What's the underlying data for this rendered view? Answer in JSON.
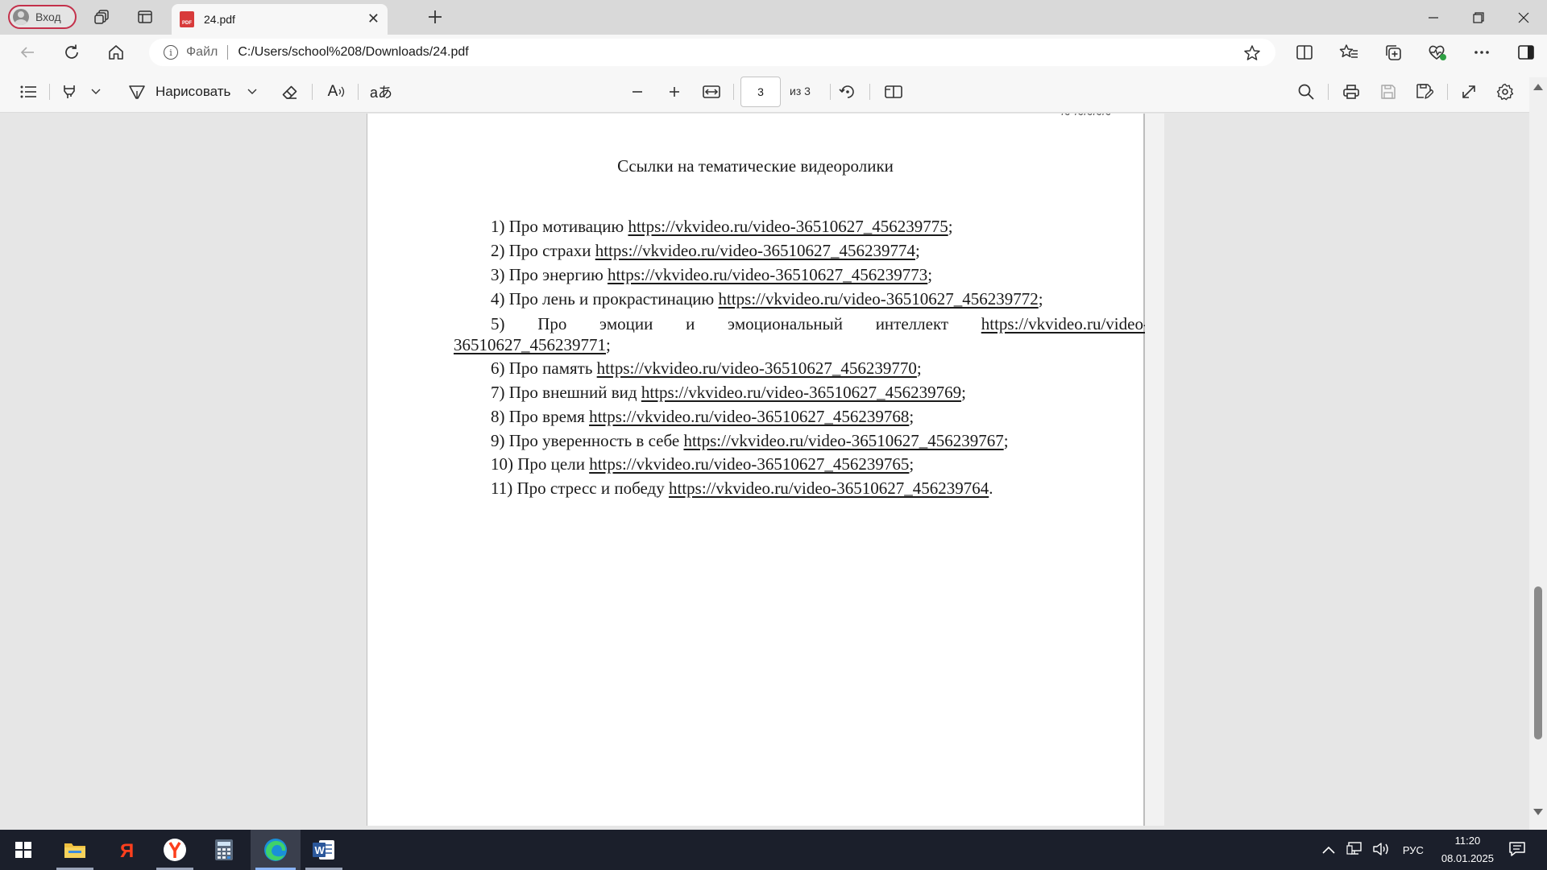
{
  "browser": {
    "profile_label": "Вход",
    "tab_title": "24.pdf",
    "favicon_text": "PDF",
    "address": {
      "file_label": "Файл",
      "url": "C:/Users/school%208/Downloads/24.pdf"
    }
  },
  "pdf_toolbar": {
    "draw_label": "Нарисовать",
    "translate_glyph": "aあ",
    "read_aloud_glyph": "A",
    "current_page": "3",
    "page_total": "из 3"
  },
  "document": {
    "title": "Ссылки на тематические видеоролики",
    "items": [
      {
        "prefix": "1) Про мотивацию ",
        "link": "https://vkvideo.ru/video-36510627_456239775",
        "suffix": ";"
      },
      {
        "prefix": "2) Про страхи ",
        "link": "https://vkvideo.ru/video-36510627_456239774",
        "suffix": ";"
      },
      {
        "prefix": "3) Про энергию ",
        "link": "https://vkvideo.ru/video-36510627_456239773",
        "suffix": ";"
      },
      {
        "prefix": "4) Про лень и прокрастинацию ",
        "link": "https://vkvideo.ru/video-36510627_456239772",
        "suffix": ";"
      },
      {
        "prefix": "6) Про память ",
        "link": "https://vkvideo.ru/video-36510627_456239770",
        "suffix": ";"
      },
      {
        "prefix": "7) Про внешний вид ",
        "link": "https://vkvideo.ru/video-36510627_456239769",
        "suffix": ";"
      },
      {
        "prefix": "8) Про время ",
        "link": "https://vkvideo.ru/video-36510627_456239768",
        "suffix": ";"
      },
      {
        "prefix": "9) Про уверенность в себе ",
        "link": "https://vkvideo.ru/video-36510627_456239767",
        "suffix": ";"
      },
      {
        "prefix": "10) Про цели ",
        "link": "https://vkvideo.ru/video-36510627_456239765",
        "suffix": ";"
      },
      {
        "prefix": "11) Про стресс и победу ",
        "link": "https://vkvideo.ru/video-36510627_456239764",
        "suffix": "."
      }
    ],
    "item5": {
      "words": [
        "5)",
        "Про",
        "эмоции",
        "и",
        "эмоциональный",
        "интеллект"
      ],
      "link_part1": "https://vkvideo.ru/video-",
      "link_part2": "36510627_456239771",
      "suffix": ";"
    }
  },
  "taskbar": {
    "apps": [
      "file-explorer",
      "yandex-search",
      "yandex-browser",
      "calculator",
      "microsoft-edge",
      "microsoft-word"
    ],
    "language": "РУС",
    "time": "11:20",
    "date": "08.01.2025"
  }
}
